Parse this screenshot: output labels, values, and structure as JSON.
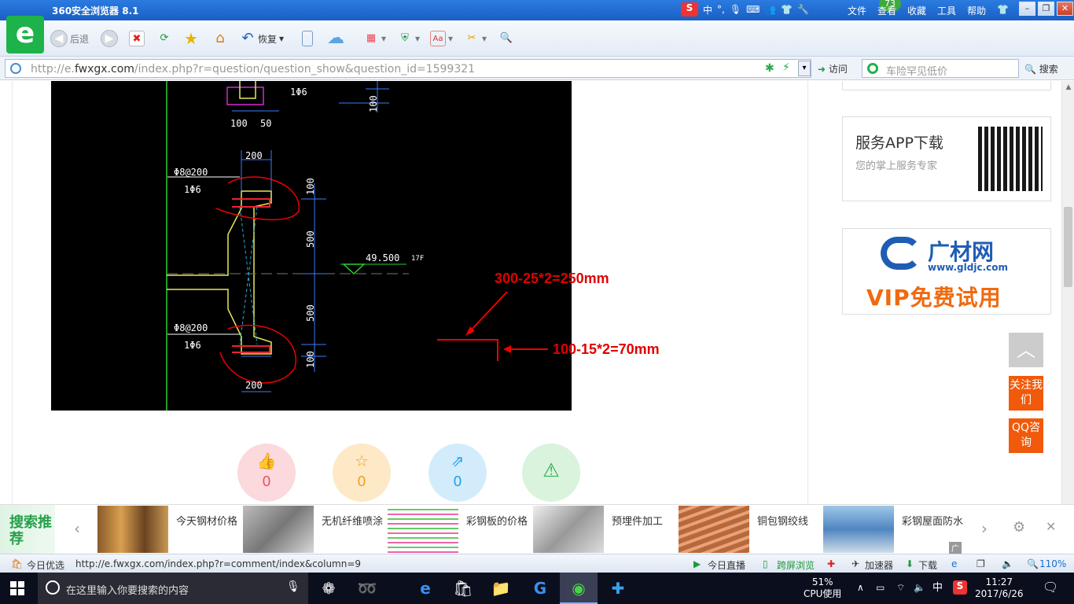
{
  "window": {
    "title": "360安全浏览器 8.1",
    "badge": "73",
    "ime_label": "中",
    "menu": [
      "文件",
      "查看",
      "收藏",
      "工具",
      "帮助"
    ]
  },
  "toolbar": {
    "back_label": "后退",
    "restore_label": "恢复"
  },
  "address": {
    "url_scheme": "http://e.",
    "url_host": "fwxgx.com",
    "url_path": "/index.php?r=question/question_show&question_id=1599321",
    "visit_label": "访问",
    "search_placeholder": "车险罕见低价",
    "search_label": "搜索"
  },
  "cad": {
    "labels": [
      "1Φ6",
      "100",
      "50",
      "100",
      "200",
      "Φ8@200",
      "1Φ6",
      "100",
      "500",
      "49.500",
      "17F",
      "500",
      "Φ8@200",
      "1Φ6",
      "100",
      "200"
    ]
  },
  "annotations": {
    "top": "300-25*2=250mm",
    "right": "100-15*2=70mm"
  },
  "actions": {
    "like_count": "0",
    "fav_count": "0",
    "share_count": "0"
  },
  "sidebar": {
    "app_title": "服务APP下载",
    "app_sub": "您的掌上服务专家",
    "ad_brand": "广材网",
    "ad_url": "www.gldjc.com",
    "ad_vip": "VIP免费试用",
    "follow": "关注我们",
    "qq": "QQ咨询"
  },
  "recommend": {
    "label": "搜索推荐",
    "items": [
      "今天钢材价格",
      "无机纤维喷涂",
      "彩钢板的价格",
      "预埋件加工",
      "铜包钢绞线",
      "彩钢屋面防水"
    ],
    "ad_tag": "广告"
  },
  "status": {
    "today_pick": "今日优选",
    "hover_url": "http://e.fwxgx.com/index.php?r=comment/index&column=9",
    "live": "今日直播",
    "cross": "跨屏浏览",
    "accel": "加速器",
    "download": "下载",
    "zoom": "110%"
  },
  "taskbar": {
    "search_placeholder": "在这里输入你要搜索的内容",
    "cpu_pct": "51%",
    "cpu_label": "CPU使用",
    "ime": "中",
    "time": "11:27",
    "date": "2017/6/26"
  },
  "colors": {
    "accent_green": "#1eb34a",
    "annotation_red": "#e00000",
    "orange": "#f05a0a"
  }
}
